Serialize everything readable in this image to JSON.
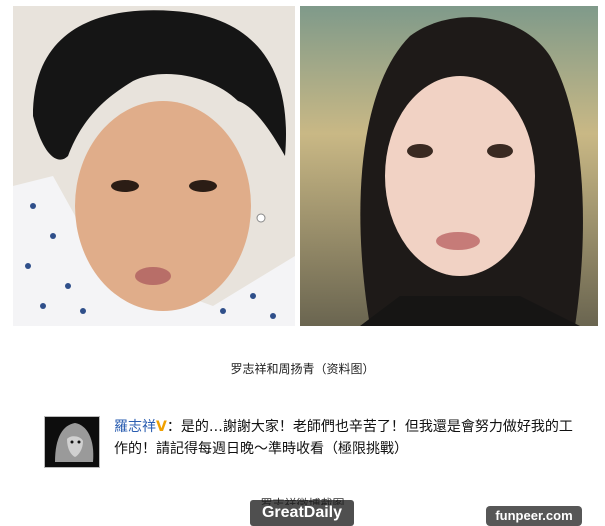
{
  "photos": {
    "left_description": "",
    "right_description": ""
  },
  "caption": "罗志祥和周扬青（资料图）",
  "post": {
    "username": "羅志祥",
    "verified_mark": "V",
    "separator": "：",
    "message": "是的…謝謝大家！老師們也辛苦了！但我還是會努力做好我的工作的！請記得每週日晚～準時收看（極限挑戰）"
  },
  "crop_text": "罗志祥微博截图",
  "watermarks": {
    "left": "GreatDaily",
    "right": "funpeer.com"
  },
  "colors": {
    "username": "#2a5db0",
    "verified": "#f0a000"
  }
}
